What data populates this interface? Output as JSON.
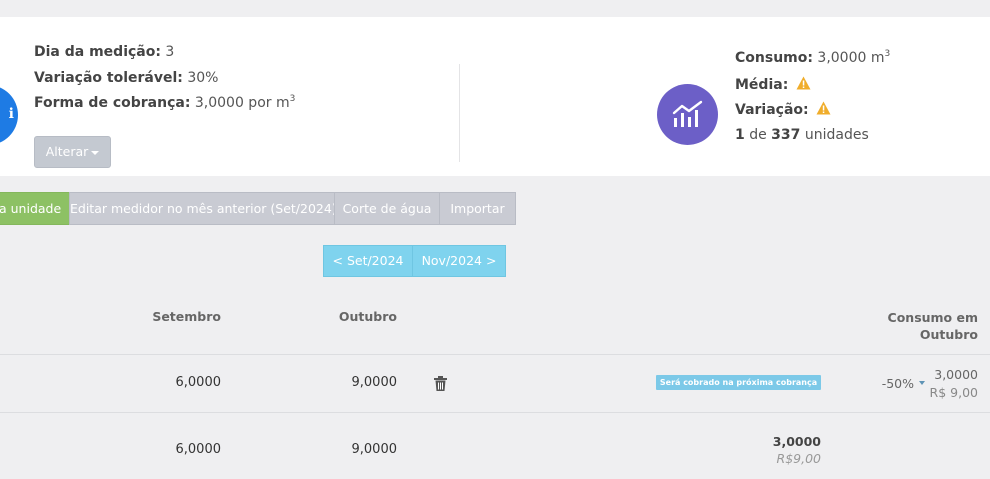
{
  "summary": {
    "dia_medicao_label": "Dia da medição:",
    "dia_medicao_value": "3",
    "variacao_label": "Variação tolerável:",
    "variacao_value": "30%",
    "forma_label": "Forma de cobrança:",
    "forma_value": "3,0000 por m",
    "forma_sup": "3",
    "alterar_label": "Alterar",
    "consumo_label": "Consumo:",
    "consumo_value": "3,0000 m",
    "consumo_sup": "3",
    "media_label": "Média:",
    "variacao2_label": "Variação:",
    "unit_index": "1",
    "unit_of": "de",
    "unit_total": "337",
    "unit_suffix": "unidades",
    "blue_icon": "info-circle-icon",
    "chart_icon": "line-chart-icon",
    "warning_icon": "warning-icon"
  },
  "tabs": [
    {
      "label": "a unidade",
      "active": true
    },
    {
      "label": "Editar medidor no mês anterior (Set/2024)",
      "active": false
    },
    {
      "label": "Corte de água",
      "active": false
    },
    {
      "label": "Importar",
      "active": false
    }
  ],
  "nav": {
    "prev_label": "< Set/2024",
    "next_label": "Nov/2024 >"
  },
  "table": {
    "headers": {
      "setembro": "Setembro",
      "outubro": "Outubro",
      "consumo_line1": "Consumo em",
      "consumo_line2": "Outubro"
    },
    "row": {
      "setembro": "6,0000",
      "outubro": "9,0000",
      "badge": "Será cobrado na próxima cobrança",
      "variation": "-50%",
      "consumo": "3,0000",
      "valor": "R$ 9,00"
    },
    "totals": {
      "setembro": "6,0000",
      "outubro": "9,0000",
      "consumo": "3,0000",
      "valor": "R$9,00"
    }
  },
  "colors": {
    "green": "#8dc164",
    "gray_button": "#c9cbd3",
    "cyan": "#7fd3ee",
    "purple": "#6c5fc7",
    "blue": "#1e7be4",
    "warning": "#f0ad2b"
  }
}
